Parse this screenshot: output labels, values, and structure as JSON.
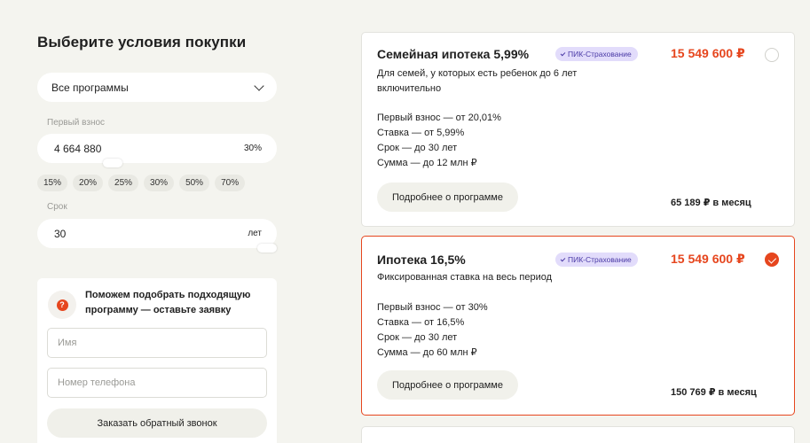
{
  "page_title": "Выберите условия покупки",
  "program_select": {
    "value": "Все программы"
  },
  "down_payment": {
    "label": "Первый взнос",
    "value": "4 664 880",
    "percent": "30%",
    "slider_fraction": 0.3
  },
  "percent_chips": [
    "15%",
    "20%",
    "25%",
    "30%",
    "50%",
    "70%"
  ],
  "term": {
    "label": "Срок",
    "value": "30",
    "unit": "лет",
    "slider_fraction": 1.0
  },
  "lead_form": {
    "text": "Поможем подобрать подходящую программу — оставьте заявку",
    "icon": "question-icon",
    "icon_glyph": "?",
    "name_placeholder": "Имя",
    "phone_placeholder": "Номер телефона",
    "button": "Заказать обратный звонок"
  },
  "colors": {
    "accent": "#e6461e",
    "badge_bg": "#e2dcfb",
    "background": "#f4f4ef"
  },
  "programs": [
    {
      "title": "Семейная ипотека 5,99%",
      "badge": "ПИК-Страхование",
      "price": "15 549 600 ₽",
      "selected": false,
      "description": "Для семей, у которых есть ребенок до 6 лет включительно",
      "terms": [
        "Первый взнос — от 20,01%",
        "Ставка — от 5,99%",
        "Срок — до 30 лет",
        "Сумма — до 12 млн ₽"
      ],
      "more": "Подробнее о программе",
      "monthly": "65 189 ₽ в месяц"
    },
    {
      "title": "Ипотека 16,5%",
      "badge": "ПИК-Страхование",
      "price": "15 549 600 ₽",
      "selected": true,
      "description": "Фиксированная ставка на весь период",
      "terms": [
        "Первый взнос — от 30%",
        "Ставка — от 16,5%",
        "Срок — до 30 лет",
        "Сумма — до 60 млн ₽"
      ],
      "more": "Подробнее о программе",
      "monthly": "150 769 ₽ в месяц"
    }
  ]
}
